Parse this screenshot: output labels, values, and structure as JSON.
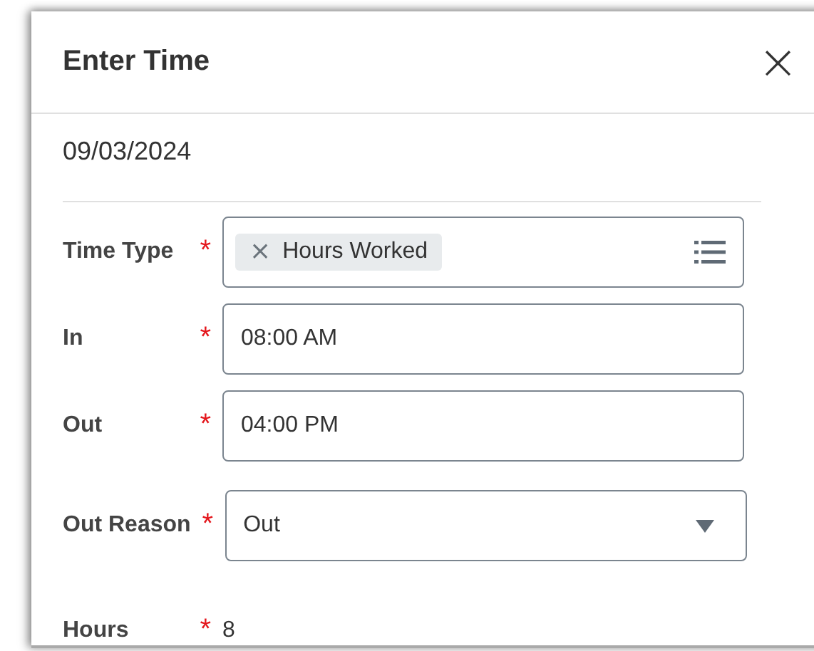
{
  "dialog": {
    "title": "Enter Time",
    "close": "×",
    "date": "09/03/2024"
  },
  "fields": [
    {
      "kind": "multiselect",
      "label": "Time Type",
      "required_mark": "*",
      "tags": [
        "Hours Worked"
      ],
      "tag_remove": "×"
    },
    {
      "kind": "text",
      "label": "In",
      "required_mark": "*",
      "value": "08:00 AM"
    },
    {
      "kind": "text",
      "label": "Out",
      "required_mark": "*",
      "value": "04:00 PM"
    },
    {
      "kind": "select",
      "label": "Out Reason",
      "required_mark": "*",
      "value": "Out"
    },
    {
      "kind": "readonly",
      "label": "Hours",
      "required_mark": "*",
      "value": "8"
    }
  ]
}
